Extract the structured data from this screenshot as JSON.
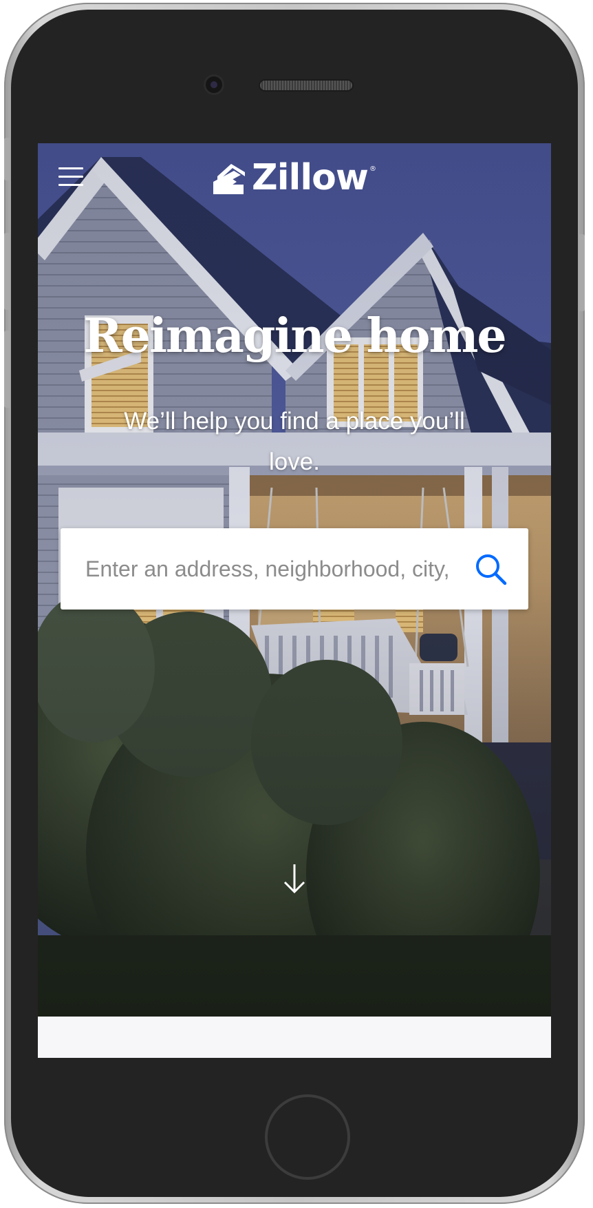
{
  "header": {
    "brand_name": "Zillow",
    "brand_mark_icon": "zillow-house-icon",
    "menu_icon": "hamburger-menu-icon"
  },
  "hero": {
    "headline": "Reimagine home",
    "subheadline": "We’ll help you find a place you’ll love.",
    "background": "house-porch-photo-at-dusk"
  },
  "search": {
    "placeholder": "Enter an address, neighborhood, city, or ZIP code",
    "value": "",
    "button_icon": "search-icon"
  },
  "scroll_hint": {
    "icon": "arrow-down-icon"
  },
  "colors": {
    "accent": "#006aff",
    "text_on_hero": "#ffffff",
    "page_background": "#f7f7fa"
  }
}
